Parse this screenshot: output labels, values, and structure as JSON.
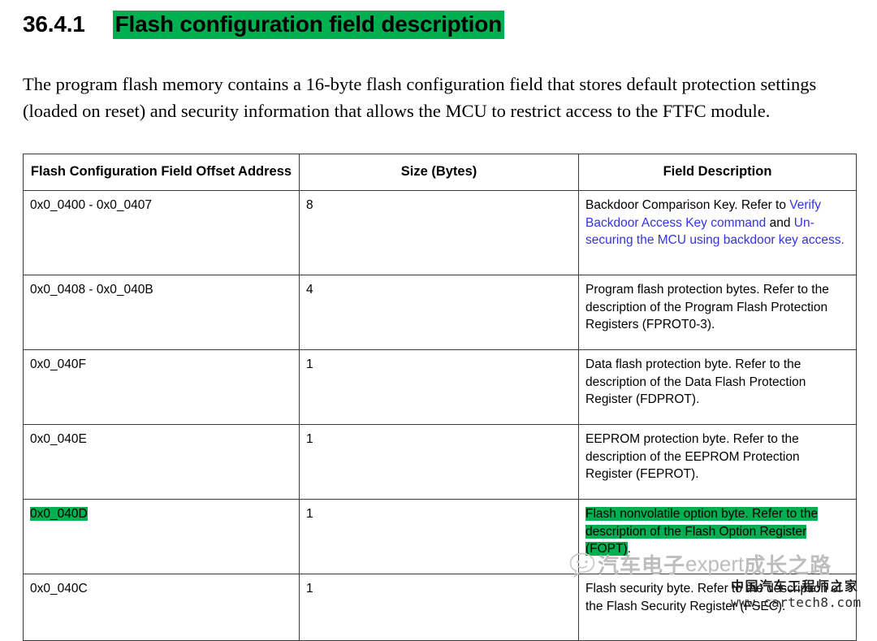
{
  "heading": {
    "number": "36.4.1",
    "title": "Flash configuration field description",
    "title_highlight_color": "#00b050"
  },
  "intro": {
    "text": "The program flash memory contains a 16-byte flash configuration field that stores default protection settings (loaded on reset) and security information that allows the MCU to restrict access to the FTFC module."
  },
  "table": {
    "headers": {
      "address": "Flash Configuration Field Offset Address",
      "size": "Size (Bytes)",
      "description": "Field Description"
    },
    "link_color": "#3333dd",
    "highlight_color": "#00b050",
    "rows": [
      {
        "address": "0x0_0400 - 0x0_0407",
        "size": "8",
        "desc_plain_1": "Backdoor Comparison Key. Refer to ",
        "desc_link_1": "Verify Backdoor Access Key command",
        "desc_plain_2": " and ",
        "desc_link_2": "Un-securing the MCU using backdoor key access.",
        "address_highlighted": false,
        "description_highlighted": false
      },
      {
        "address": "0x0_0408 - 0x0_040B",
        "size": "4",
        "description": "Program flash protection bytes. Refer to the description of the Program Flash Protection Registers (FPROT0-3).",
        "address_highlighted": false,
        "description_highlighted": false
      },
      {
        "address": "0x0_040F",
        "size": "1",
        "description": "Data flash protection byte. Refer to the description of the Data Flash Protection Register (FDPROT).",
        "address_highlighted": false,
        "description_highlighted": false
      },
      {
        "address": "0x0_040E",
        "size": "1",
        "description": "EEPROM protection byte. Refer to the description of the EEPROM Protection Register (FEPROT).",
        "address_highlighted": false,
        "description_highlighted": false
      },
      {
        "address": "0x0_040D",
        "size": "1",
        "description": "Flash nonvolatile option byte. Refer to the description of the Flash Option Register (FOPT)",
        "description_tail": ".",
        "address_highlighted": true,
        "description_highlighted": true
      },
      {
        "address": "0x0_040C",
        "size": "1",
        "description": "Flash security byte. Refer to the description of the Flash Security Register (FSEC).",
        "address_highlighted": false,
        "description_highlighted": false
      }
    ]
  },
  "watermark": {
    "brand_cn": "汽车电子",
    "brand_en": "expert",
    "brand_cn_2": "成长之路",
    "organization": "中国汽车工程师之家",
    "url": "www.cartech8.com"
  }
}
